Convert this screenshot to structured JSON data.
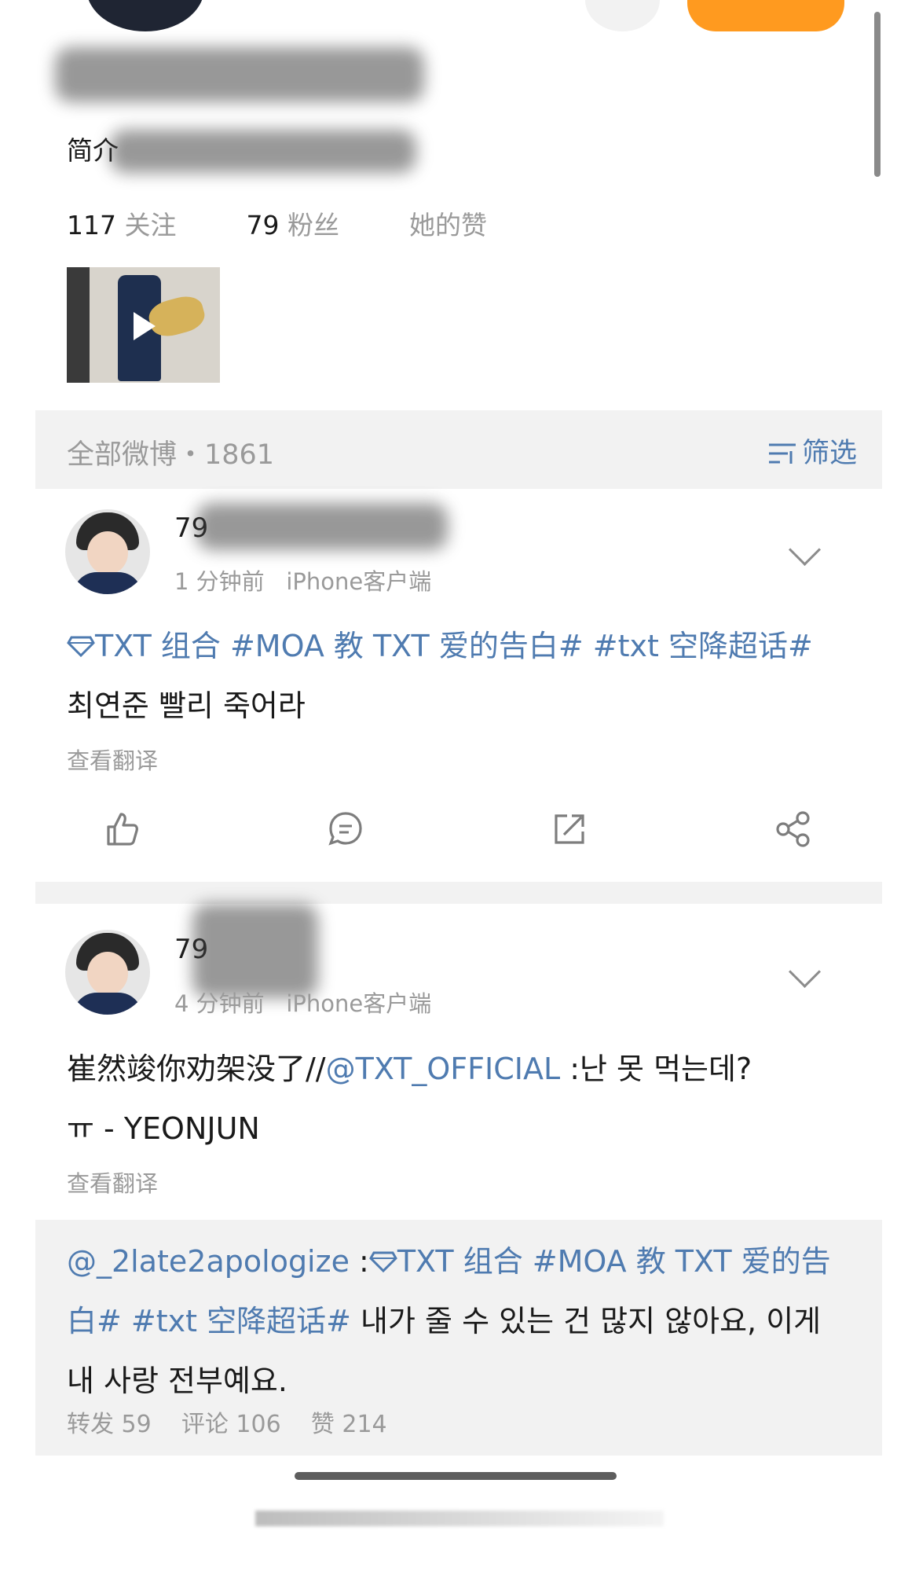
{
  "profile": {
    "intro_label": "简介",
    "following_count": "117",
    "following_label": "关注",
    "followers_count": "79",
    "followers_label": "粉丝",
    "likes_label": "她的赞"
  },
  "feed_header": {
    "title": "全部微博・1861",
    "filter_label": "筛选"
  },
  "posts": [
    {
      "username": "79",
      "time": "1 分钟前",
      "source": "iPhone客户端",
      "content_link": "TXT 组合 #MOA 教 TXT 爱的告白# #txt 空降超话#",
      "content_text": "최연준 빨리 죽어라",
      "translate_label": "查看翻译"
    },
    {
      "username": "79",
      "time": "4 分钟前",
      "source": "iPhone客户端",
      "content_prefix": "崔然竣你劝架没了//",
      "content_mention": "@TXT_OFFICIAL",
      "content_suffix": " :난 못 먹는데?",
      "content_line2": "ㅠ - YEONJUN",
      "translate_label": "查看翻译",
      "repost": {
        "mention": "@_2late2apologize",
        "colon": " :",
        "topic_link": "TXT 组合 #MOA 教 TXT 爱的告白# #txt 空降超话#",
        "text": " 내가 줄 수 있는 건 많지 않아요, 이게 내 사랑 전부예요.",
        "repost_count_label": "转发 59",
        "comment_count_label": "评论 106",
        "like_count_label": "赞 214"
      }
    }
  ],
  "icons": [
    "like-icon",
    "comment-icon",
    "repost-icon",
    "share-icon",
    "chevron-down-icon",
    "diamond-icon",
    "filter-icon",
    "play-icon"
  ]
}
